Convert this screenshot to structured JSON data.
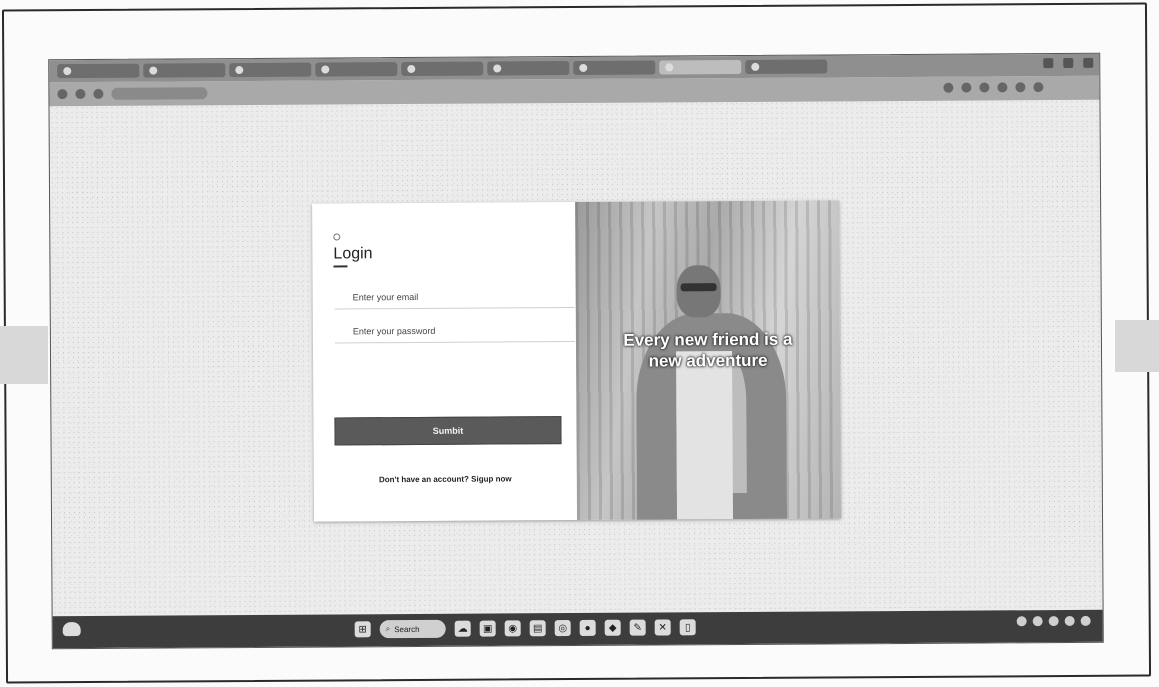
{
  "browser": {
    "tabs": [
      "",
      "",
      "",
      "",
      "",
      "",
      "",
      "",
      ""
    ],
    "address": ""
  },
  "login": {
    "title": "Login",
    "email_placeholder": "Enter your email",
    "password_placeholder": "Enter your password",
    "submit_label": "Sumbit",
    "signup_text": "Don't have an account? Sigup now"
  },
  "hero": {
    "line1": "Every new friend is a",
    "line2": "new adventure"
  },
  "taskbar": {
    "search_label": "Search"
  },
  "icons": [
    "start-icon",
    "search-icon",
    "weather-icon",
    "file-explorer-icon",
    "browser-icon",
    "mail-icon",
    "settings-icon",
    "vscode-icon",
    "terminal-icon"
  ],
  "colors": {
    "submit_bg": "#5a5a5a",
    "taskbar_bg": "#3d3d3d"
  }
}
